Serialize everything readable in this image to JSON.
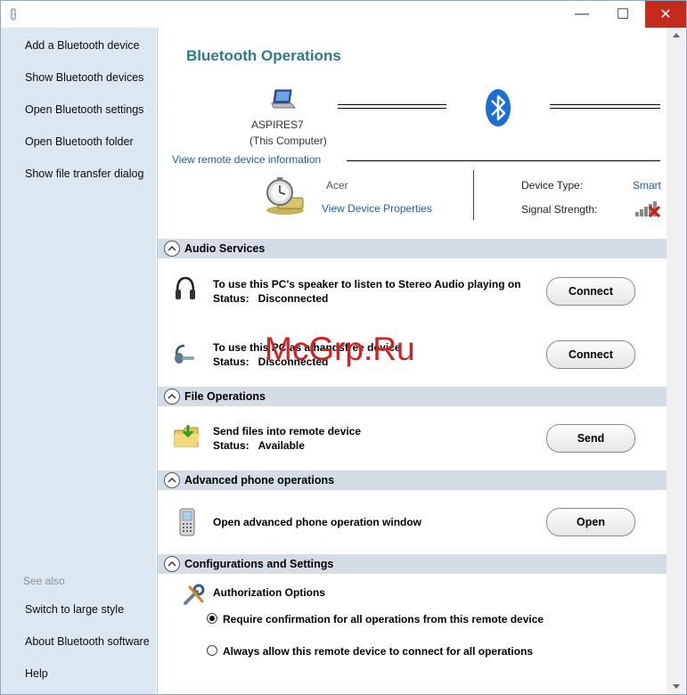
{
  "window": {
    "minimize": "—",
    "maximize": "☐",
    "close": "✕"
  },
  "sidebar": {
    "items": [
      {
        "label": "Add a Bluetooth device"
      },
      {
        "label": "Show Bluetooth devices"
      },
      {
        "label": "Open Bluetooth settings"
      },
      {
        "label": "Open Bluetooth folder"
      },
      {
        "label": "Show file transfer dialog"
      }
    ],
    "see_also_label": "See also",
    "see_also": [
      {
        "label": "Switch to large style"
      },
      {
        "label": "About Bluetooth software"
      },
      {
        "label": "Help"
      }
    ]
  },
  "main": {
    "title": "Bluetooth Operations",
    "computer_name": "ASPIRES7",
    "computer_caption": "(This Computer)",
    "remote_info_link": "View remote device information",
    "device_name": "Acer",
    "device_props_link": "View Device Properties",
    "device_type_label": "Device Type:",
    "device_type_value": "Smart",
    "signal_label": "Signal Strength:"
  },
  "sections": {
    "audio": {
      "title": "Audio Services",
      "items": [
        {
          "title": "To use this PC's speaker to listen to Stereo Audio playing on",
          "status_label": "Status:",
          "status": "Disconnected",
          "button": "Connect"
        },
        {
          "title": "To use this PC as a handsfree device",
          "status_label": "Status:",
          "status": "Disconnected",
          "button": "Connect"
        }
      ]
    },
    "file": {
      "title": "File Operations",
      "item": {
        "title": "Send files into remote device",
        "status_label": "Status:",
        "status": "Available",
        "button": "Send"
      }
    },
    "phone": {
      "title": "Advanced phone operations",
      "item": {
        "title": "Open advanced phone operation window",
        "button": "Open"
      }
    },
    "config": {
      "title": "Configurations and Settings",
      "auth_title": "Authorization Options",
      "options": [
        {
          "label": "Require confirmation for all operations from this remote device",
          "selected": true
        },
        {
          "label": "Always allow this remote device to connect for all operations",
          "selected": false
        }
      ]
    }
  },
  "watermark": "McGrp.Ru",
  "colors": {
    "accent": "#2a7d8d",
    "link": "#1f5ea8",
    "sidebar_bg": "#dbe8f1",
    "section_bar": "#d4dde6",
    "close_red": "#c42b1c",
    "watermark": "#d42020"
  }
}
